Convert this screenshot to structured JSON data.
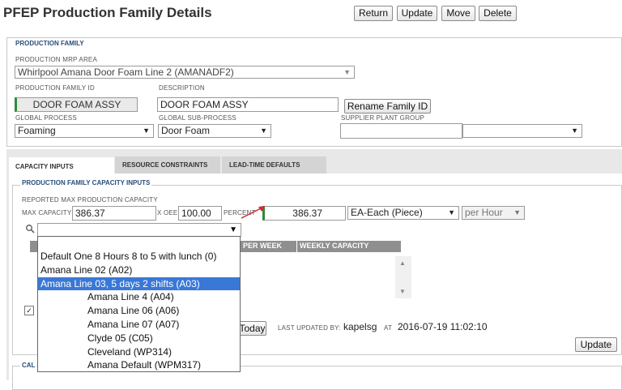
{
  "page": {
    "title": "PFEP Production Family Details",
    "buttons": {
      "return": "Return",
      "update": "Update",
      "move": "Move",
      "delete": "Delete"
    }
  },
  "production_family": {
    "section_label": "PRODUCTION FAMILY",
    "mrp_area_label": "PRODUCTION MRP AREA",
    "mrp_area_value": "Whirlpool Amana Door Foam Line 2 (AMANADF2)",
    "family_id_label": "PRODUCTION FAMILY ID",
    "family_id_value": "DOOR FOAM ASSY",
    "description_label": "DESCRIPTION",
    "description_value": "DOOR FOAM ASSY",
    "rename_button": "Rename Family ID",
    "global_process_label": "GLOBAL PROCESS",
    "global_process_value": "Foaming",
    "global_subprocess_label": "GLOBAL SUB-PROCESS",
    "global_subprocess_value": "Door Foam",
    "supplier_group_label": "SUPPLIER PLANT GROUP",
    "supplier_group_value": "",
    "supplier_group_select": ""
  },
  "tabs": [
    {
      "label": "CAPACITY INPUTS",
      "active": true
    },
    {
      "label": "RESOURCE CONSTRAINTS",
      "active": false
    },
    {
      "label": "LEAD-TIME DEFAULTS",
      "active": false
    }
  ],
  "capacity": {
    "section_label": "PRODUCTION FAMILY CAPACITY INPUTS",
    "reported_label": "REPORTED MAX PRODUCTION CAPACITY",
    "max_capacity_label": "MAX CAPACITY",
    "max_capacity_value": "386.37",
    "x_oee_label": "X OEE",
    "oee_value": "100.00",
    "percent_label": "PERCENT",
    "result_value": "386.37",
    "uom_value": "EA-Each (Piece)",
    "per_value": "per Hour",
    "table_headers": [
      "PER WEEK",
      "WEEKLY CAPACITY"
    ],
    "today_button": "Today",
    "last_updated_label": "LAST UPDATED BY:",
    "last_updated_user": "kapelsg",
    "at_label": "AT",
    "last_updated_time": "2016-07-19 11:02:10",
    "update_button": "Update",
    "bottom_section_label": "CAL"
  },
  "calendar_dropdown": {
    "selected_value": "",
    "options": [
      {
        "label": "Default One 8 Hours 8 to 5 with lunch (0)",
        "selected": false
      },
      {
        "label": "Amana Line 02 (A02)",
        "selected": false
      },
      {
        "label": "Amana Line 03, 5 days 2 shifts (A03)",
        "selected": true
      },
      {
        "label": "Amana Line 4 (A04)",
        "selected": false
      },
      {
        "label": "Amana Line 06 (A06)",
        "selected": false
      },
      {
        "label": "Amana Line 07 (A07)",
        "selected": false
      },
      {
        "label": "Clyde 05 (C05)",
        "selected": false
      },
      {
        "label": "Cleveland (WP314)",
        "selected": false
      },
      {
        "label": "Amana Default (WPM317)",
        "selected": false
      }
    ]
  }
}
